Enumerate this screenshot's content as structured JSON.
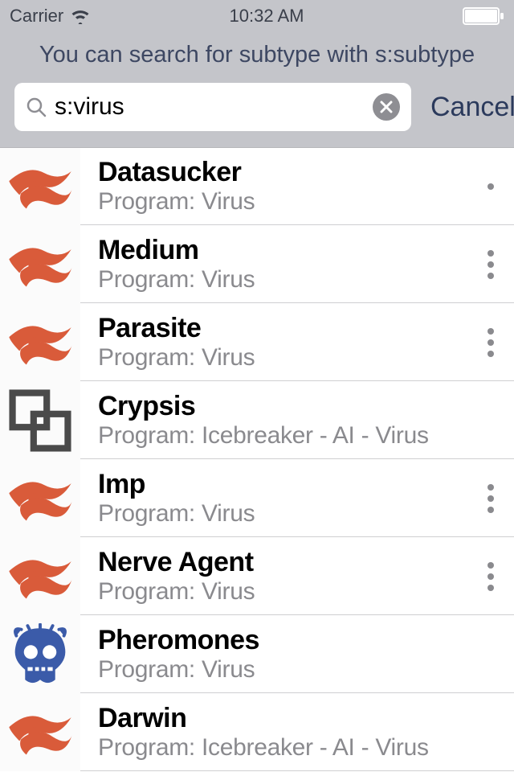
{
  "status": {
    "carrier": "Carrier",
    "time": "10:32 AM"
  },
  "hint": "You can search for subtype with s:subtype",
  "search": {
    "value": "s:virus",
    "cancel": "Cancel"
  },
  "rows": [
    {
      "icon": "anarch",
      "title": "Datasucker",
      "subtitle": "Program: Virus",
      "dots": 1
    },
    {
      "icon": "anarch",
      "title": "Medium",
      "subtitle": "Program: Virus",
      "dots": 3
    },
    {
      "icon": "anarch",
      "title": "Parasite",
      "subtitle": "Program: Virus",
      "dots": 3
    },
    {
      "icon": "shaper",
      "title": "Crypsis",
      "subtitle": "Program: Icebreaker - AI - Virus",
      "dots": 0
    },
    {
      "icon": "anarch",
      "title": "Imp",
      "subtitle": "Program: Virus",
      "dots": 3
    },
    {
      "icon": "anarch",
      "title": "Nerve Agent",
      "subtitle": "Program: Virus",
      "dots": 3
    },
    {
      "icon": "criminal",
      "title": "Pheromones",
      "subtitle": "Program: Virus",
      "dots": 0
    },
    {
      "icon": "anarch",
      "title": "Darwin",
      "subtitle": "Program: Icebreaker - AI - Virus",
      "dots": 0
    }
  ]
}
